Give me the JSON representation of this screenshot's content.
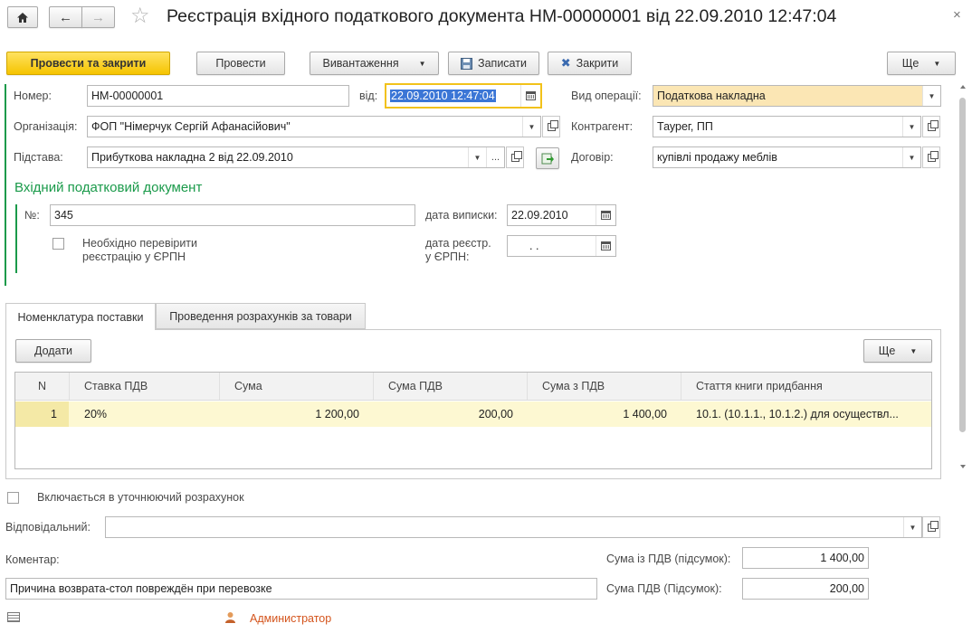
{
  "window": {
    "title": "Реєстрація вхідного податкового документа НМ-00000001 від 22.09.2010 12:47:04"
  },
  "toolbar": {
    "post_and_close": "Провести та закрити",
    "post": "Провести",
    "export": "Вивантаження",
    "save": "Записати",
    "close": "Закрити",
    "more": "Ще"
  },
  "header": {
    "number_label": "Номер:",
    "number_value": "НМ-00000001",
    "date_label": "від:",
    "date_value": "22.09.2010 12:47:04",
    "operation_label": "Вид операції:",
    "operation_value": "Податкова накладна",
    "org_label": "Організація:",
    "org_value": "ФОП \"Німерчук Сергій Афанасійович\"",
    "counterparty_label": "Контрагент:",
    "counterparty_value": "Таурег, ПП",
    "basis_label": "Підстава:",
    "basis_value": "Прибуткова накладна 2 від 22.09.2010",
    "contract_label": "Договір:",
    "contract_value": "купівлі продажу меблів"
  },
  "incoming": {
    "section_title": "Вхідний податковий документ",
    "num_label": "№:",
    "num_value": "345",
    "issue_date_label": "дата виписки:",
    "issue_date_value": "22.09.2010",
    "check_label_1": "Необхідно перевірити",
    "check_label_2": "реєстрацію у ЄРПН",
    "reg_date_label_1": "дата реєстр.",
    "reg_date_label_2": "у ЄРПН:",
    "reg_date_value": " .  ."
  },
  "tabs": [
    {
      "label": "Номенклатура поставки"
    },
    {
      "label": "Проведення розрахунків за товари"
    }
  ],
  "table": {
    "add_label": "Додати",
    "more_label": "Ще",
    "columns": [
      "N",
      "Ставка ПДВ",
      "Сума",
      "Сума ПДВ",
      "Сума з ПДВ",
      "Стаття книги придбання"
    ],
    "rows": [
      {
        "n": "1",
        "rate": "20%",
        "sum": "1 200,00",
        "vat": "200,00",
        "total": "1 400,00",
        "article": "10.1. (10.1.1., 10.1.2.)  для осуществл..."
      }
    ]
  },
  "footer": {
    "include_label": "Включається в уточнюючий розрахунок",
    "responsible_label": "Відповідальний:",
    "responsible_value": "",
    "comment_label": "Коментар:",
    "comment_value": "Причина возврата-стол повреждён при перевозке",
    "sum_with_vat_label": "Сума із ПДВ (підсумок):",
    "sum_with_vat_value": "1 400,00",
    "sum_vat_label": "Сума ПДВ (Підсумок):",
    "sum_vat_value": "200,00",
    "user": "Администратор"
  },
  "colors": {
    "accent_green": "#1a9a4a",
    "highlight_yellow": "#fbe6b4",
    "row_yellow": "#fdf8d2",
    "user_orange": "#d4541c"
  }
}
